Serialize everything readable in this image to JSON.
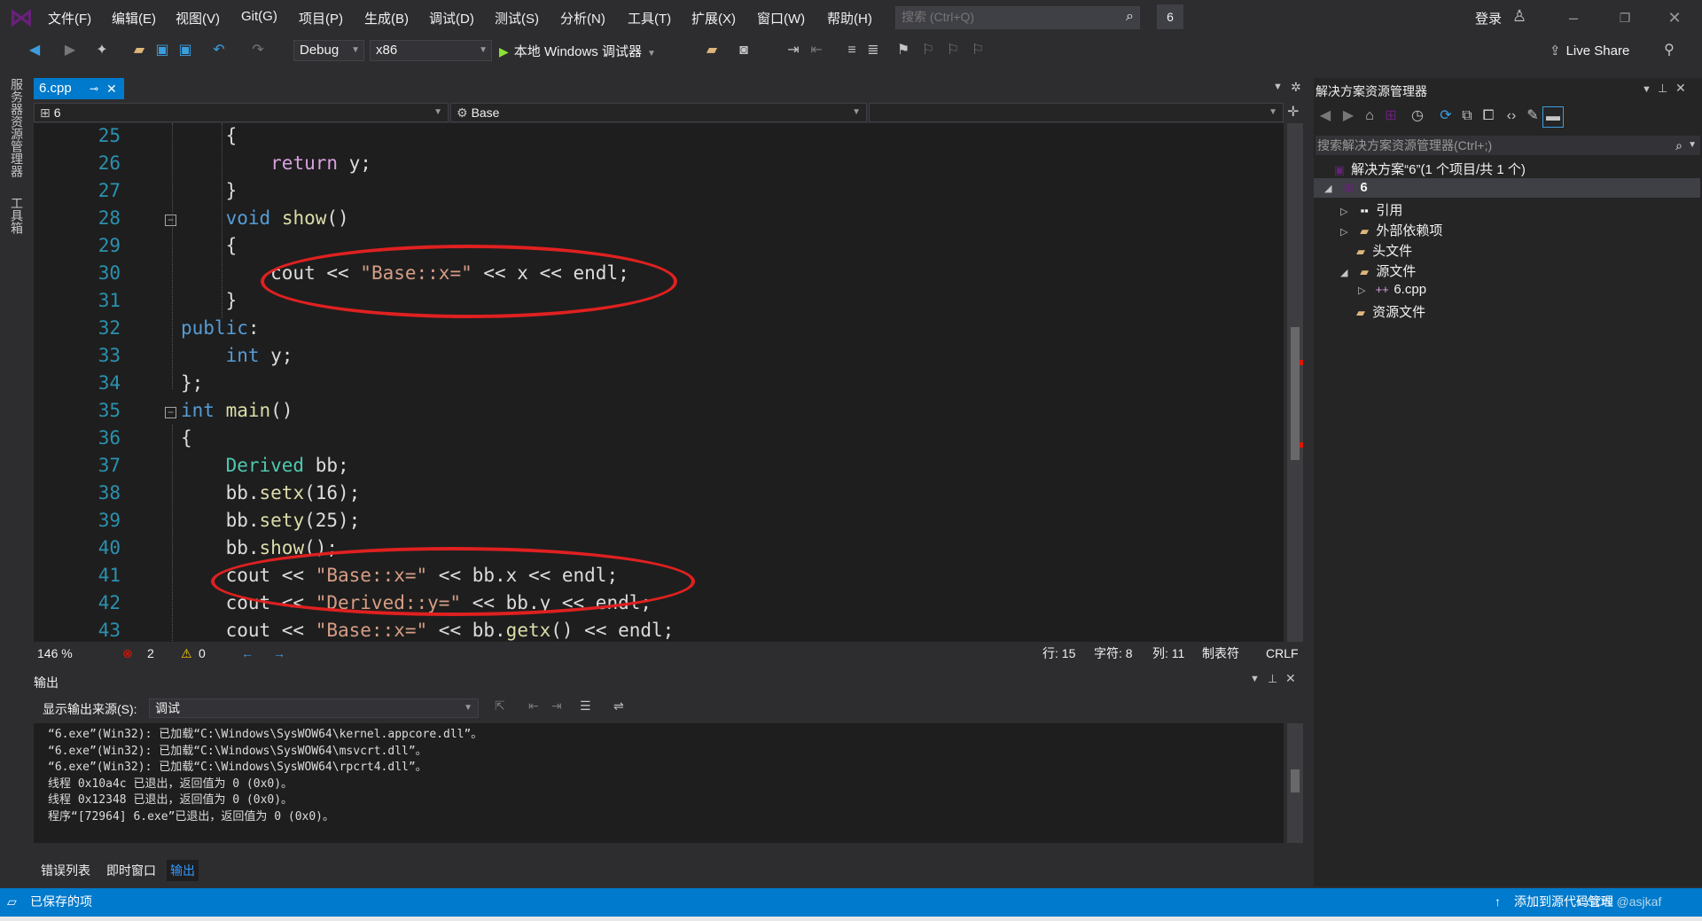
{
  "menu": [
    "文件(F)",
    "编辑(E)",
    "视图(V)",
    "Git(G)",
    "项目(P)",
    "生成(B)",
    "调试(D)",
    "测试(S)",
    "分析(N)",
    "工具(T)",
    "扩展(X)",
    "窗口(W)",
    "帮助(H)"
  ],
  "search": {
    "placeholder": "搜索 (Ctrl+Q)"
  },
  "solution_badge": "6",
  "account": {
    "login_label": "登录"
  },
  "toolbar": {
    "config": "Debug",
    "platform": "x86",
    "run_label": "本地 Windows 调试器",
    "live_share": "Live Share"
  },
  "left_strip": {
    "server_explorer": "服务器资源管理器",
    "toolbox": "工具箱"
  },
  "editor": {
    "tab_name": "6.cpp",
    "nav_project": "6",
    "nav_scope": "Base",
    "lines": [
      25,
      26,
      27,
      28,
      29,
      30,
      31,
      32,
      33,
      34,
      35,
      36,
      37,
      38,
      39,
      40,
      41,
      42,
      43
    ]
  },
  "editor_status": {
    "zoom": "146 %",
    "errors": "2",
    "warnings": "0",
    "row": "行: 15",
    "char": "字符: 8",
    "col": "列: 11",
    "tab_mode": "制表符",
    "eol": "CRLF"
  },
  "output": {
    "title": "输出",
    "source_label": "显示输出来源(S):",
    "source_value": "调试",
    "lines": [
      "“6.exe”(Win32): 已加载“C:\\Windows\\SysWOW64\\kernel.appcore.dll”。",
      "“6.exe”(Win32): 已加载“C:\\Windows\\SysWOW64\\msvcrt.dll”。",
      "“6.exe”(Win32): 已加载“C:\\Windows\\SysWOW64\\rpcrt4.dll”。",
      "线程 0x10a4c 已退出，返回值为 0 (0x0)。",
      "线程 0x12348 已退出，返回值为 0 (0x0)。",
      "程序“[72964] 6.exe”已退出，返回值为 0 (0x0)。"
    ]
  },
  "bottom_tabs": [
    "错误列表",
    "即时窗口",
    "输出"
  ],
  "solution_explorer": {
    "title": "解决方案资源管理器",
    "search_placeholder": "搜索解决方案资源管理器(Ctrl+;)",
    "solution": "解决方案“6”(1 个项目/共 1 个)",
    "project": "6",
    "items": [
      "引用",
      "外部依赖项",
      "头文件",
      "源文件",
      "6.cpp",
      "资源文件"
    ]
  },
  "statusbar": {
    "left": "已保存的项",
    "right": "添加到源代码管理",
    "watermark": "CSDN @asjkaf"
  }
}
